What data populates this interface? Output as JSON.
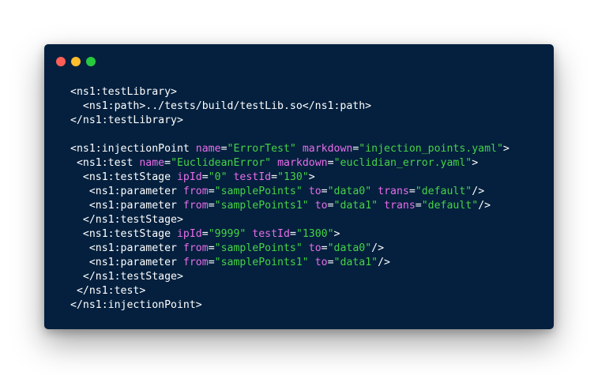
{
  "window": {
    "background": "#04203e",
    "buttons": [
      {
        "name": "close-button",
        "color": "#ff5f56"
      },
      {
        "name": "minimize-button",
        "color": "#ffbd2e"
      },
      {
        "name": "maximize-button",
        "color": "#27c93f"
      }
    ]
  },
  "syntax_colors": {
    "tag": "#ffffff",
    "attribute": "#e86dea",
    "value": "#46d346"
  },
  "code_lines": [
    {
      "indent": "",
      "tokens": [
        {
          "t": "tag",
          "v": "<ns1:testLibrary>"
        }
      ]
    },
    {
      "indent": "  ",
      "tokens": [
        {
          "t": "tag",
          "v": "<ns1:path>../tests/build/testLib.so</ns1:path>"
        }
      ]
    },
    {
      "indent": "",
      "tokens": [
        {
          "t": "tag",
          "v": "</ns1:testLibrary>"
        }
      ]
    },
    {
      "indent": "",
      "tokens": []
    },
    {
      "indent": "",
      "tokens": [
        {
          "t": "tag",
          "v": "<ns1:injectionPoint "
        },
        {
          "t": "attr",
          "v": "name"
        },
        {
          "t": "eq",
          "v": "="
        },
        {
          "t": "val",
          "v": "\"ErrorTest\""
        },
        {
          "t": "tag",
          "v": " "
        },
        {
          "t": "attr",
          "v": "markdown"
        },
        {
          "t": "eq",
          "v": "="
        },
        {
          "t": "val",
          "v": "\"injection_points.yaml\""
        },
        {
          "t": "tag",
          "v": ">"
        }
      ]
    },
    {
      "indent": " ",
      "tokens": [
        {
          "t": "tag",
          "v": "<ns1:test "
        },
        {
          "t": "attr",
          "v": "name"
        },
        {
          "t": "eq",
          "v": "="
        },
        {
          "t": "val",
          "v": "\"EuclideanError\""
        },
        {
          "t": "tag",
          "v": " "
        },
        {
          "t": "attr",
          "v": "markdown"
        },
        {
          "t": "eq",
          "v": "="
        },
        {
          "t": "val",
          "v": "\"euclidian_error.yaml\""
        },
        {
          "t": "tag",
          "v": ">"
        }
      ]
    },
    {
      "indent": "  ",
      "tokens": [
        {
          "t": "tag",
          "v": "<ns1:testStage "
        },
        {
          "t": "attr",
          "v": "ipId"
        },
        {
          "t": "eq",
          "v": "="
        },
        {
          "t": "val",
          "v": "\"0\""
        },
        {
          "t": "tag",
          "v": " "
        },
        {
          "t": "attr",
          "v": "testId"
        },
        {
          "t": "eq",
          "v": "="
        },
        {
          "t": "val",
          "v": "\"130\""
        },
        {
          "t": "tag",
          "v": ">"
        }
      ]
    },
    {
      "indent": "   ",
      "tokens": [
        {
          "t": "tag",
          "v": "<ns1:parameter "
        },
        {
          "t": "attr",
          "v": "from"
        },
        {
          "t": "eq",
          "v": "="
        },
        {
          "t": "val",
          "v": "\"samplePoints\""
        },
        {
          "t": "tag",
          "v": " "
        },
        {
          "t": "attr",
          "v": "to"
        },
        {
          "t": "eq",
          "v": "="
        },
        {
          "t": "val",
          "v": "\"data0\""
        },
        {
          "t": "tag",
          "v": " "
        },
        {
          "t": "attr",
          "v": "trans"
        },
        {
          "t": "eq",
          "v": "="
        },
        {
          "t": "val",
          "v": "\"default\""
        },
        {
          "t": "tag",
          "v": "/>"
        }
      ]
    },
    {
      "indent": "   ",
      "tokens": [
        {
          "t": "tag",
          "v": "<ns1:parameter "
        },
        {
          "t": "attr",
          "v": "from"
        },
        {
          "t": "eq",
          "v": "="
        },
        {
          "t": "val",
          "v": "\"samplePoints1\""
        },
        {
          "t": "tag",
          "v": " "
        },
        {
          "t": "attr",
          "v": "to"
        },
        {
          "t": "eq",
          "v": "="
        },
        {
          "t": "val",
          "v": "\"data1\""
        },
        {
          "t": "tag",
          "v": " "
        },
        {
          "t": "attr",
          "v": "trans"
        },
        {
          "t": "eq",
          "v": "="
        },
        {
          "t": "val",
          "v": "\"default\""
        },
        {
          "t": "tag",
          "v": "/>"
        }
      ]
    },
    {
      "indent": "  ",
      "tokens": [
        {
          "t": "tag",
          "v": "</ns1:testStage>"
        }
      ]
    },
    {
      "indent": "  ",
      "tokens": [
        {
          "t": "tag",
          "v": "<ns1:testStage "
        },
        {
          "t": "attr",
          "v": "ipId"
        },
        {
          "t": "eq",
          "v": "="
        },
        {
          "t": "val",
          "v": "\"9999\""
        },
        {
          "t": "tag",
          "v": " "
        },
        {
          "t": "attr",
          "v": "testId"
        },
        {
          "t": "eq",
          "v": "="
        },
        {
          "t": "val",
          "v": "\"1300\""
        },
        {
          "t": "tag",
          "v": ">"
        }
      ]
    },
    {
      "indent": "   ",
      "tokens": [
        {
          "t": "tag",
          "v": "<ns1:parameter "
        },
        {
          "t": "attr",
          "v": "from"
        },
        {
          "t": "eq",
          "v": "="
        },
        {
          "t": "val",
          "v": "\"samplePoints\""
        },
        {
          "t": "tag",
          "v": " "
        },
        {
          "t": "attr",
          "v": "to"
        },
        {
          "t": "eq",
          "v": "="
        },
        {
          "t": "val",
          "v": "\"data0\""
        },
        {
          "t": "tag",
          "v": "/>"
        }
      ]
    },
    {
      "indent": "   ",
      "tokens": [
        {
          "t": "tag",
          "v": "<ns1:parameter "
        },
        {
          "t": "attr",
          "v": "from"
        },
        {
          "t": "eq",
          "v": "="
        },
        {
          "t": "val",
          "v": "\"samplePoints1\""
        },
        {
          "t": "tag",
          "v": " "
        },
        {
          "t": "attr",
          "v": "to"
        },
        {
          "t": "eq",
          "v": "="
        },
        {
          "t": "val",
          "v": "\"data1\""
        },
        {
          "t": "tag",
          "v": "/>"
        }
      ]
    },
    {
      "indent": "  ",
      "tokens": [
        {
          "t": "tag",
          "v": "</ns1:testStage>"
        }
      ]
    },
    {
      "indent": " ",
      "tokens": [
        {
          "t": "tag",
          "v": "</ns1:test>"
        }
      ]
    },
    {
      "indent": "",
      "tokens": [
        {
          "t": "tag",
          "v": "</ns1:injectionPoint>"
        }
      ]
    }
  ]
}
